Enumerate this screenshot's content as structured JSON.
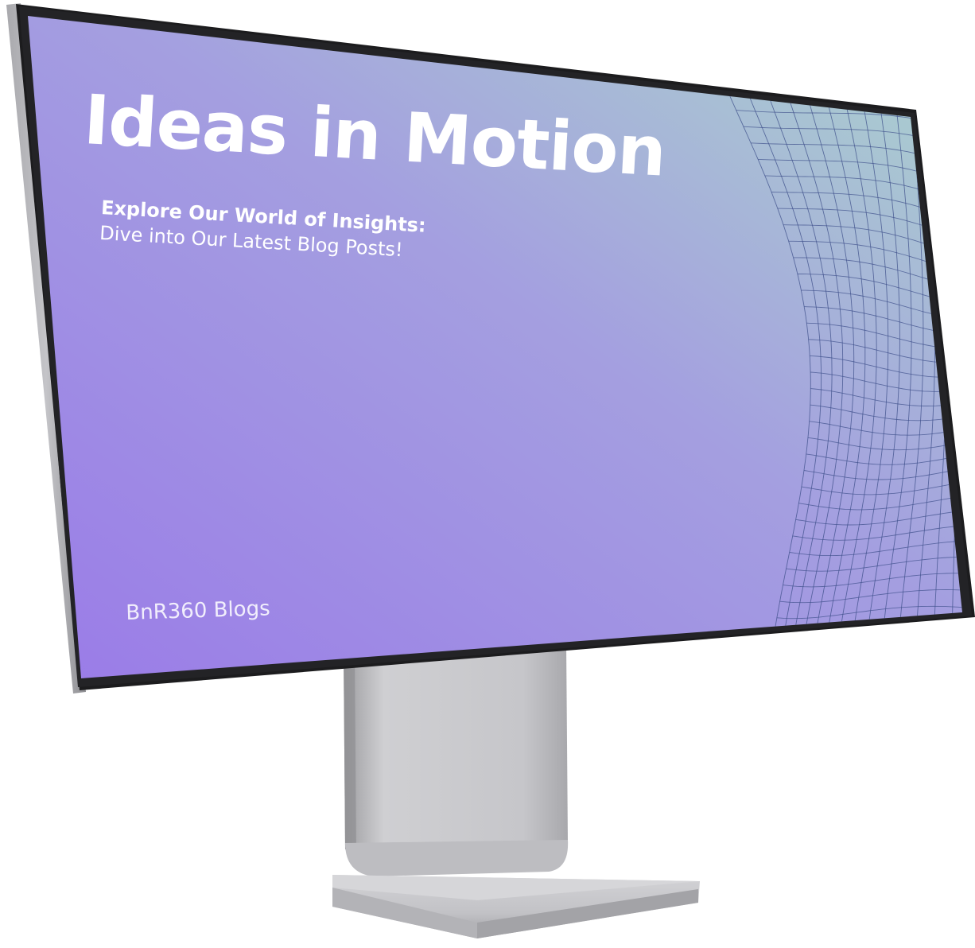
{
  "screen": {
    "title": "Ideas in Motion",
    "subtitle_line1": "Explore Our World of Insights:",
    "subtitle_line2": "Dive into Our Latest Blog Posts!",
    "brand": "BnR360 Blogs"
  },
  "colors": {
    "gradient_start": "#9a7fe6",
    "gradient_mid": "#a59fe0",
    "gradient_end": "#a8d4cf",
    "wave_lines": "#3d4f8a",
    "bezel": "#1e1e20",
    "frame": "#b8b8bc",
    "stand": "#c8c8cc"
  }
}
